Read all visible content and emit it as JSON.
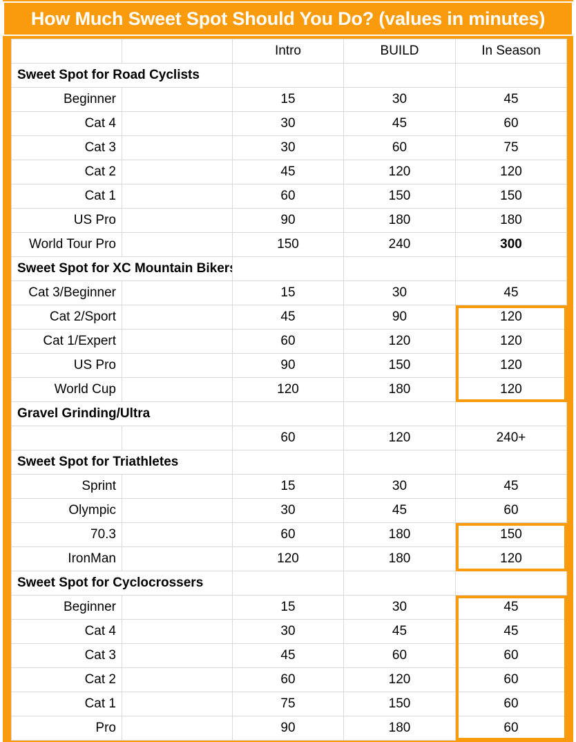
{
  "title": "How Much Sweet Spot Should You Do? (values in minutes)",
  "colors": {
    "accent": "#f99b0c",
    "grid": "#d9d9d9",
    "text": "#000000",
    "title_text": "#ffffff"
  },
  "table": {
    "headers": [
      "",
      "",
      "Intro",
      "BUILD",
      "In Season"
    ],
    "rows": [
      {
        "type": "header",
        "label": "",
        "blank": "",
        "intro": "Intro",
        "build": "BUILD",
        "season": "In Season"
      },
      {
        "type": "section",
        "label": "Sweet Spot for Road Cyclists"
      },
      {
        "type": "data",
        "label": "Beginner",
        "blank": "",
        "intro": "15",
        "build": "30",
        "season": "45"
      },
      {
        "type": "data",
        "label": "Cat 4",
        "blank": "",
        "intro": "30",
        "build": "45",
        "season": "60"
      },
      {
        "type": "data",
        "label": "Cat 3",
        "blank": "",
        "intro": "30",
        "build": "60",
        "season": "75"
      },
      {
        "type": "data",
        "label": "Cat 2",
        "blank": "",
        "intro": "45",
        "build": "120",
        "season": "120"
      },
      {
        "type": "data",
        "label": "Cat 1",
        "blank": "",
        "intro": "60",
        "build": "150",
        "season": "150"
      },
      {
        "type": "data",
        "label": "US Pro",
        "blank": "",
        "intro": "90",
        "build": "180",
        "season": "180"
      },
      {
        "type": "data",
        "label": "World Tour Pro",
        "blank": "",
        "intro": "150",
        "build": "240",
        "season": "300",
        "season_filled": true
      },
      {
        "type": "section",
        "label": "Sweet Spot for XC Mountain Bikers"
      },
      {
        "type": "data",
        "label": "Cat 3/Beginner",
        "blank": "",
        "intro": "15",
        "build": "30",
        "season": "45"
      },
      {
        "type": "data",
        "label": "Cat 2/Sport",
        "blank": "",
        "intro": "45",
        "build": "90",
        "season": "120"
      },
      {
        "type": "data",
        "label": "Cat 1/Expert",
        "blank": "",
        "intro": "60",
        "build": "120",
        "season": "120"
      },
      {
        "type": "data",
        "label": "US Pro",
        "blank": "",
        "intro": "90",
        "build": "150",
        "season": "120"
      },
      {
        "type": "data",
        "label": "World Cup",
        "blank": "",
        "intro": "120",
        "build": "180",
        "season": "120"
      },
      {
        "type": "section",
        "label": "Gravel Grinding/Ultra"
      },
      {
        "type": "data",
        "label": "",
        "blank": "",
        "intro": "60",
        "build": "120",
        "season": "240+"
      },
      {
        "type": "section",
        "label": "Sweet Spot for Triathletes"
      },
      {
        "type": "data",
        "label": "Sprint",
        "blank": "",
        "intro": "15",
        "build": "30",
        "season": "45"
      },
      {
        "type": "data",
        "label": "Olympic",
        "blank": "",
        "intro": "30",
        "build": "45",
        "season": "60"
      },
      {
        "type": "data",
        "label": "70.3",
        "blank": "",
        "intro": "60",
        "build": "180",
        "season": "150"
      },
      {
        "type": "data",
        "label": "IronMan",
        "blank": "",
        "intro": "120",
        "build": "180",
        "season": "120"
      },
      {
        "type": "section",
        "label": "Sweet Spot for Cyclocrossers"
      },
      {
        "type": "data",
        "label": "Beginner",
        "blank": "",
        "intro": "15",
        "build": "30",
        "season": "45"
      },
      {
        "type": "data",
        "label": "Cat 4",
        "blank": "",
        "intro": "30",
        "build": "45",
        "season": "45"
      },
      {
        "type": "data",
        "label": "Cat 3",
        "blank": "",
        "intro": "45",
        "build": "60",
        "season": "60"
      },
      {
        "type": "data",
        "label": "Cat 2",
        "blank": "",
        "intro": "60",
        "build": "120",
        "season": "60"
      },
      {
        "type": "data",
        "label": "Cat 1",
        "blank": "",
        "intro": "75",
        "build": "150",
        "season": "60"
      },
      {
        "type": "data",
        "label": "Pro",
        "blank": "",
        "intro": "90",
        "build": "180",
        "season": "60"
      }
    ]
  },
  "highlights": [
    {
      "name": "xc-in-season-box",
      "row_start": 11,
      "row_end": 14,
      "column": "season"
    },
    {
      "name": "triathlete-in-season-box",
      "row_start": 20,
      "row_end": 21,
      "column": "season"
    },
    {
      "name": "cyclocross-in-season-box",
      "row_start": 23,
      "row_end": 28,
      "column": "season"
    }
  ]
}
